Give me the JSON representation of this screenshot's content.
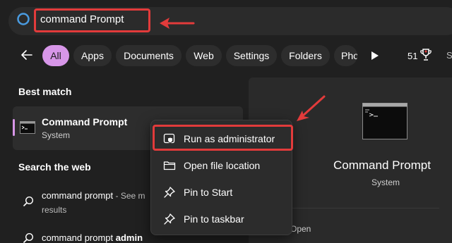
{
  "search": {
    "value": "command Prompt"
  },
  "filters": {
    "chips": [
      {
        "label": "All",
        "active": true
      },
      {
        "label": "Apps",
        "active": false
      },
      {
        "label": "Documents",
        "active": false
      },
      {
        "label": "Web",
        "active": false
      },
      {
        "label": "Settings",
        "active": false
      },
      {
        "label": "Folders",
        "active": false
      },
      {
        "label": "Pho",
        "active": false
      }
    ],
    "points": "51",
    "more": "S"
  },
  "left": {
    "best_match_label": "Best match",
    "best": {
      "title": "Command Prompt",
      "subtitle": "System"
    },
    "search_web_label": "Search the web",
    "web_results": [
      {
        "text": "command prompt",
        "sub": " - See m",
        "line2": "results"
      },
      {
        "text_plain": "command prompt ",
        "text_bold": "admin"
      }
    ]
  },
  "right": {
    "title": "Command Prompt",
    "subtitle": "System",
    "action": "Open"
  },
  "context_menu": {
    "items": [
      {
        "label": "Run as administrator",
        "icon": "shield-icon"
      },
      {
        "label": "Open file location",
        "icon": "folder-icon"
      },
      {
        "label": "Pin to Start",
        "icon": "pin-icon"
      },
      {
        "label": "Pin to taskbar",
        "icon": "pin-icon"
      }
    ]
  },
  "colors": {
    "accent": "#d796e8",
    "highlight": "#e23b3b",
    "background": "#202020"
  }
}
